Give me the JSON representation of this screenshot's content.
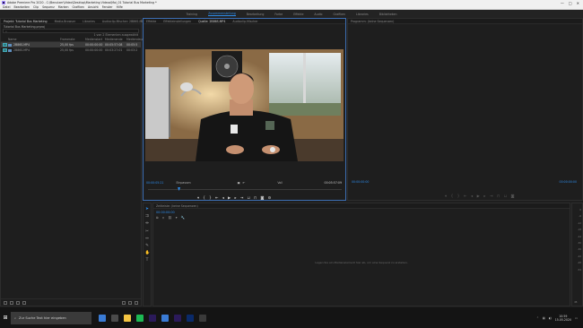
{
  "window": {
    "title": "Adobe Premiere Pro 2020 - C:\\Benutzer\\Video\\Desktop\\Marketing Videos\\Mai_01 Tutorial Bus Marketing *",
    "controls": [
      "—",
      "□",
      "✕"
    ]
  },
  "menu": [
    "Datei",
    "Bearbeiten",
    "Clip",
    "Sequenz",
    "Marken",
    "Grafiken",
    "Ansicht",
    "Fenster",
    "Hilfe"
  ],
  "workspaces": {
    "items": [
      "Training",
      "Zusammenstellung",
      "Bearbeitung",
      "Farbe",
      "Effekte",
      "Audio",
      "Grafiken",
      "Libraries",
      "Bibliotheken"
    ],
    "active_index": 1
  },
  "project": {
    "tabs": [
      "Projekt: Tutorial Bus Marketing",
      "Media-Browser",
      "Libraries",
      "Audioclip-Mischer: 2B86S-MP4"
    ],
    "path": "Tutorial Bus Marketing.prproj",
    "search_placeholder": "",
    "count": "1 von 2 Elementen ausgewählt",
    "columns": [
      "Name",
      "Framerate",
      "Medienstart",
      "Medienende",
      "Mediendauer"
    ],
    "rows": [
      {
        "name": "2B86S.MP4",
        "framerate": "25,00 fps",
        "start": "00:00:00:00",
        "end": "00:05:57:08",
        "duration": "00:05:57:09",
        "selected": true
      },
      {
        "name": "2B86S.MP4",
        "framerate": "25,00 fps",
        "start": "00:00:00:00",
        "end": "00:03:27:01",
        "duration": "00:03:27:02",
        "selected": false
      }
    ]
  },
  "source": {
    "tabs": [
      "Effekte",
      "Effekteinstellungen",
      "Quelle: 2B86S.MP4",
      "Audioclip-Mischer"
    ],
    "active_tab": 2,
    "timecode_left": "00:00:05:21",
    "fit": "Einpassen",
    "full": "Voll",
    "timecode_right": "00:05:57:09",
    "playhead_fraction": 0.16
  },
  "program": {
    "tabs": [
      "Programm: (keine Sequenzen)"
    ],
    "timecode_left": "00:00:00:00",
    "timecode_right": "00:00:00:00"
  },
  "timeline": {
    "tabs": [
      "Zeitleiste: (keine Sequenzen)"
    ],
    "timecode": "00:00:00:00",
    "empty_message": "Legen Sie ein Medienelement hier ab, um eine Sequenz zu erstellen."
  },
  "meters": {
    "labels": [
      "0",
      "-6",
      "-12",
      "-18",
      "-24",
      "-30",
      "-36",
      "-42",
      "-48",
      "-54"
    ],
    "foot": "dB"
  },
  "taskbar": {
    "search_placeholder": "Zur Suche Text hier eingeben",
    "time": "10:59",
    "date": "15.05.2020",
    "apps": [
      "#3a7bd5",
      "#4a4a4a",
      "#f5c542",
      "#1db954",
      "#2b1a5a",
      "#3a7bd5",
      "#2b1a5a",
      "#0a2a6a",
      "#3a3a3a"
    ]
  },
  "colors": {
    "accent": "#2d8ceb",
    "panel": "#1e1e1e",
    "border": "#2d2d2d"
  }
}
